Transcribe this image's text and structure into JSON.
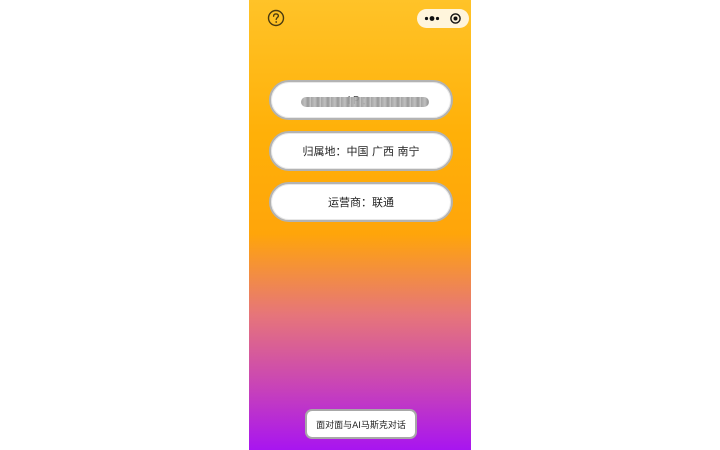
{
  "header": {
    "help_icon": "help-circle-icon",
    "capsule": {
      "more_icon": "more-dots-icon",
      "close_icon": "target-close-icon"
    }
  },
  "info": {
    "ip_label": "IP：",
    "ip_value_redacted": true,
    "location": "归属地：中国 广西 南宁",
    "isp": "运营商：联通"
  },
  "footer": {
    "chat_button": "面对面与AI马斯克对话"
  },
  "colors": {
    "gradient_top": "#ffc328",
    "gradient_mid": "#ffa50a",
    "gradient_bottom": "#a815f0",
    "pill_border": "#b3b3b3"
  }
}
